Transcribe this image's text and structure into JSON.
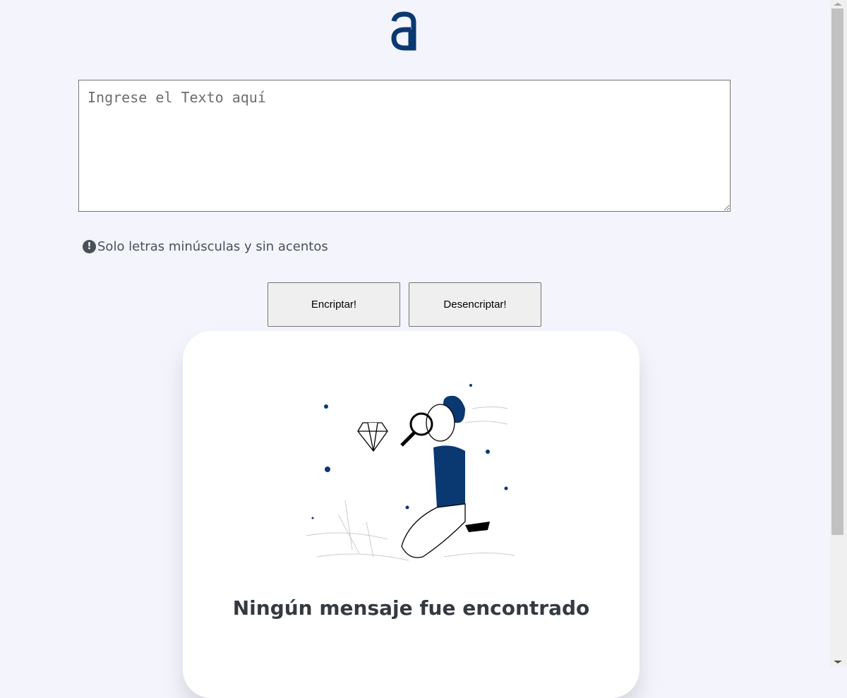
{
  "logo": {
    "text": "a",
    "color": "#0a3871"
  },
  "input": {
    "placeholder": "Ingrese el Texto aquí",
    "value": ""
  },
  "hint": {
    "icon": "!",
    "text": "Solo letras minúsculas y sin acentos"
  },
  "buttons": {
    "encrypt": "Encriptar!",
    "decrypt": "Desencriptar!"
  },
  "output": {
    "title": "Ningún mensaje fue encontrado"
  }
}
